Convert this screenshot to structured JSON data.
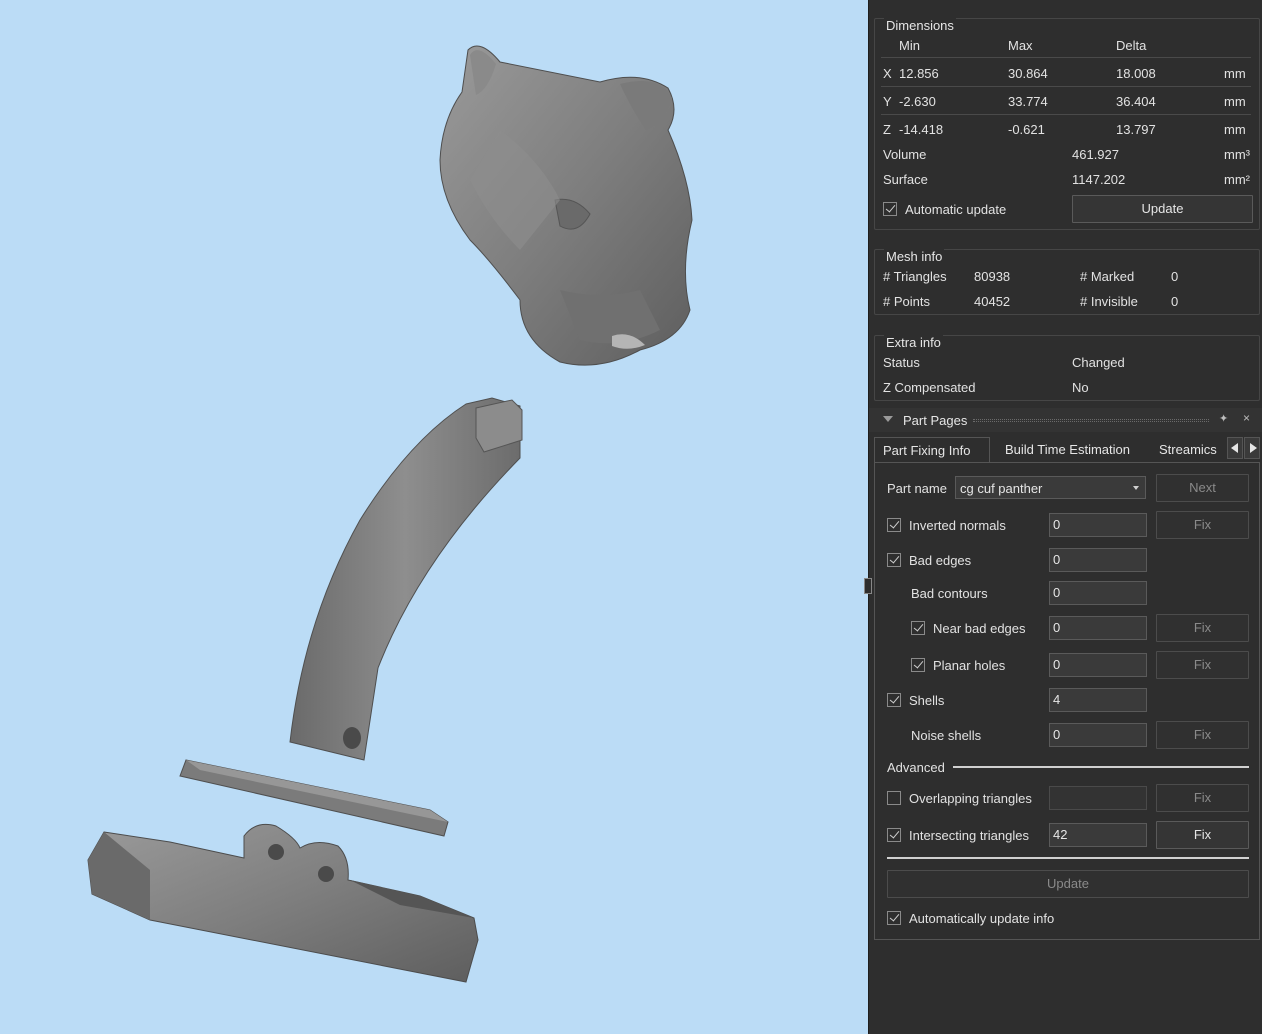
{
  "dimensions": {
    "title": "Dimensions",
    "headers": {
      "min": "Min",
      "max": "Max",
      "delta": "Delta"
    },
    "rows": [
      {
        "axis": "X",
        "min": "12.856",
        "max": "30.864",
        "delta": "18.008",
        "unit": "mm"
      },
      {
        "axis": "Y",
        "min": "-2.630",
        "max": "33.774",
        "delta": "36.404",
        "unit": "mm"
      },
      {
        "axis": "Z",
        "min": "-14.418",
        "max": "-0.621",
        "delta": "13.797",
        "unit": "mm"
      }
    ],
    "volume": {
      "label": "Volume",
      "value": "461.927",
      "unit": "mm³"
    },
    "surface": {
      "label": "Surface",
      "value": "1147.202",
      "unit": "mm²"
    },
    "auto_update_label": "Automatic update",
    "auto_update_checked": true,
    "update_label": "Update"
  },
  "mesh_info": {
    "title": "Mesh info",
    "triangles_label": "# Triangles",
    "triangles": "80938",
    "marked_label": "# Marked",
    "marked": "0",
    "points_label": "# Points",
    "points": "40452",
    "invisible_label": "# Invisible",
    "invisible": "0"
  },
  "extra_info": {
    "title": "Extra info",
    "status_label": "Status",
    "status": "Changed",
    "zcomp_label": "Z Compensated",
    "zcomp": "No"
  },
  "part_pages": {
    "title": "Part Pages",
    "tabs": [
      "Part Fixing Info",
      "Build Time Estimation",
      "Streamics P"
    ],
    "part_name_label": "Part name",
    "part_name": "cg cuf panther",
    "next_label": "Next",
    "fix_label": "Fix",
    "rows": {
      "inverted_normals": {
        "label": "Inverted normals",
        "value": "0"
      },
      "bad_edges": {
        "label": "Bad edges",
        "value": "0"
      },
      "bad_contours": {
        "label": "Bad contours",
        "value": "0"
      },
      "near_bad_edges": {
        "label": "Near bad edges",
        "value": "0"
      },
      "planar_holes": {
        "label": "Planar holes",
        "value": "0"
      },
      "shells": {
        "label": "Shells",
        "value": "4"
      },
      "noise_shells": {
        "label": "Noise shells",
        "value": "0"
      },
      "overlapping": {
        "label": "Overlapping triangles",
        "value": ""
      },
      "intersecting": {
        "label": "Intersecting triangles",
        "value": "42"
      }
    },
    "advanced_label": "Advanced",
    "update_label": "Update",
    "auto_update_label": "Automatically update info"
  }
}
